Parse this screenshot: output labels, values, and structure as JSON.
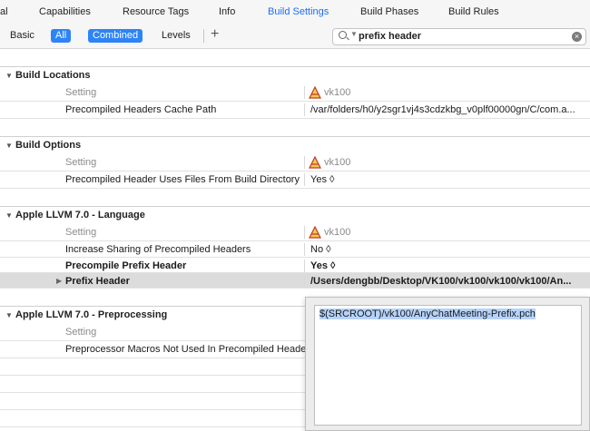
{
  "tabs": [
    "al",
    "Capabilities",
    "Resource Tags",
    "Info",
    "Build Settings",
    "Build Phases",
    "Build Rules"
  ],
  "filter": {
    "basic": "Basic",
    "all": "All",
    "combined": "Combined",
    "levels": "Levels",
    "plus": "+"
  },
  "search": {
    "value": "prefix header",
    "clear": "×"
  },
  "sections": {
    "build_locations": {
      "title": "Build Locations",
      "header_setting": "Setting",
      "header_target": "vk100",
      "rows": [
        {
          "name": "Precompiled Headers Cache Path",
          "value": "/var/folders/h0/y2sgr1vj4s3cdzkbg_v0plf00000gn/C/com.a..."
        }
      ]
    },
    "build_options": {
      "title": "Build Options",
      "header_setting": "Setting",
      "header_target": "vk100",
      "rows": [
        {
          "name": "Precompiled Header Uses Files From Build Directory",
          "value": "Yes ◊"
        }
      ]
    },
    "llvm_language": {
      "title": "Apple LLVM 7.0 - Language",
      "header_setting": "Setting",
      "header_target": "vk100",
      "rows": [
        {
          "name": "Increase Sharing of Precompiled Headers",
          "value": "No ◊"
        },
        {
          "name": "Precompile Prefix Header",
          "value": "Yes ◊"
        },
        {
          "name": "Prefix Header",
          "value": "/Users/dengbb/Desktop/VK100/vk100/vk100/vk100/An..."
        }
      ]
    },
    "llvm_preprocessing": {
      "title": "Apple LLVM 7.0 - Preprocessing",
      "header_setting": "Setting",
      "rows": [
        {
          "name": "Preprocessor Macros Not Used In Precompiled Headers"
        }
      ]
    }
  },
  "popover": {
    "text": "$(SRCROOT)/vk100/AnyChatMeeting-Prefix.pch"
  },
  "colors": {
    "accent": "#2d84f7",
    "tab_active": "#1b6ff5",
    "selected_row": "#dcdcdc",
    "selection_text": "#b5d3fb"
  },
  "icons": {
    "target": "target-app-icon",
    "search": "search-icon",
    "clear": "clear-icon",
    "disclosure": "disclosure-triangle-icon"
  }
}
